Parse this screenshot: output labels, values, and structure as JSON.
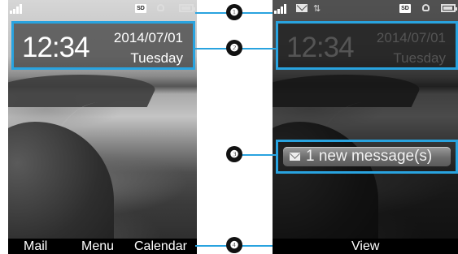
{
  "accent_color": "#29a3df",
  "left_screen": {
    "status_icons": [
      "signal-icon",
      "sd-card-icon",
      "alarm-icon",
      "battery-icon"
    ],
    "sd_label": "SD",
    "clock": {
      "time": "12:34",
      "date": "2014/07/01",
      "day": "Tuesday"
    },
    "softkeys": {
      "left": "Mail",
      "center": "Menu",
      "right": "Calendar"
    }
  },
  "right_screen": {
    "status_icons": [
      "signal-icon",
      "message-icon",
      "data-arrows-icon",
      "sd-card-icon",
      "alarm-icon",
      "battery-icon"
    ],
    "sd_label": "SD",
    "clock": {
      "time": "12:34",
      "date": "2014/07/01",
      "day": "Tuesday"
    },
    "notification": {
      "text": "1 new message(s)"
    },
    "softkeys": {
      "center": "View"
    }
  },
  "callouts": [
    "❶",
    "❷",
    "❸",
    "❹"
  ]
}
